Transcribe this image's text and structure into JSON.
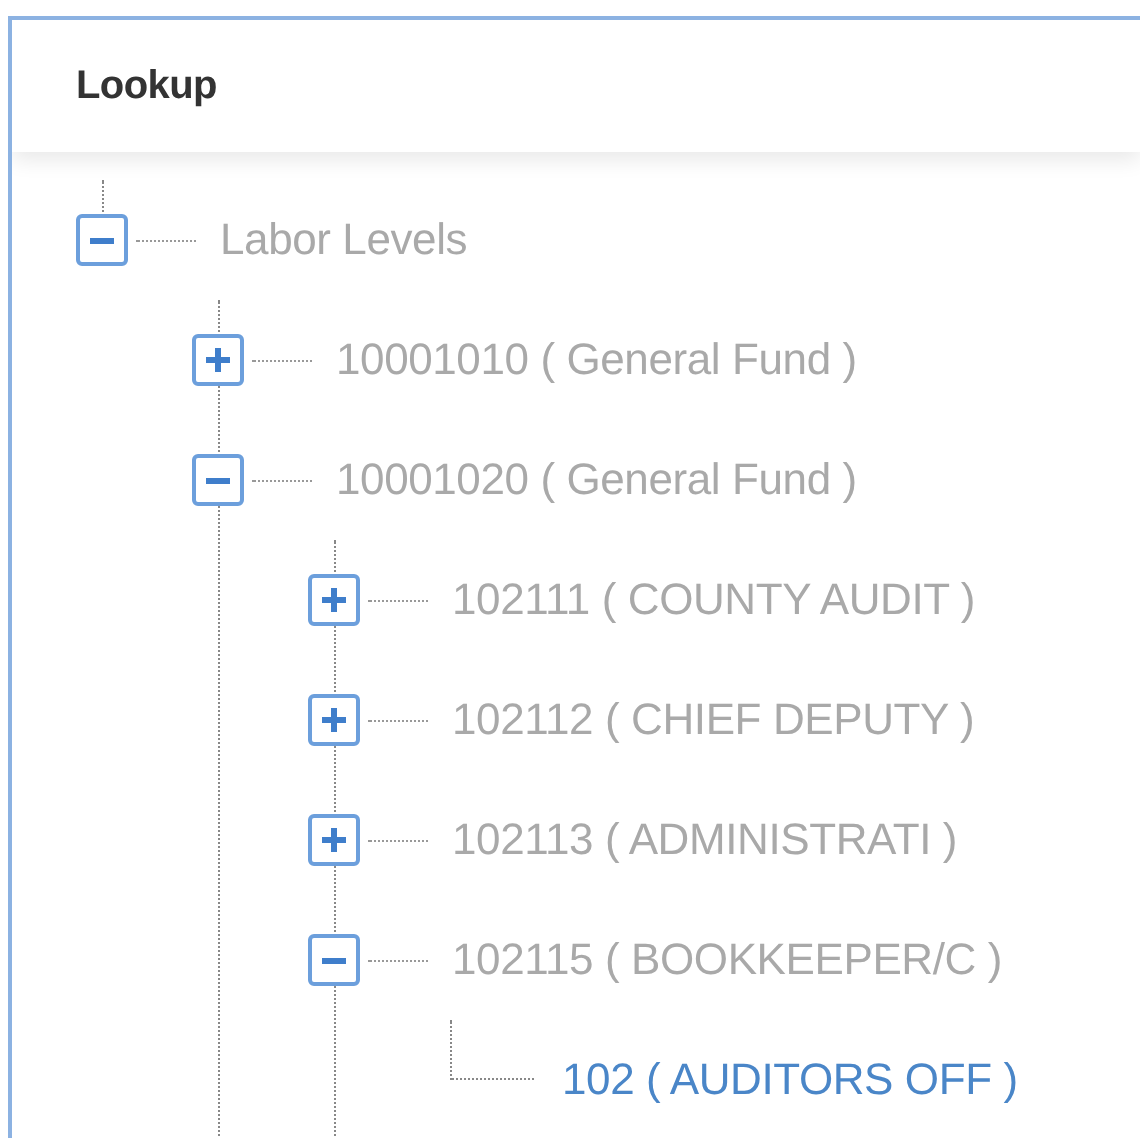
{
  "panel": {
    "title": "Lookup"
  },
  "tree": [
    {
      "kind": "branch",
      "label": "Labor Levels",
      "expanded": true,
      "selected": false,
      "children": [
        {
          "kind": "branch",
          "label": "10001010 ( General Fund )",
          "expanded": false,
          "selected": false
        },
        {
          "kind": "branch",
          "label": "10001020 ( General Fund )",
          "expanded": true,
          "selected": false,
          "children": [
            {
              "kind": "branch",
              "label": "102111 ( COUNTY AUDIT )",
              "expanded": false,
              "selected": false
            },
            {
              "kind": "branch",
              "label": "102112 ( CHIEF DEPUTY )",
              "expanded": false,
              "selected": false
            },
            {
              "kind": "branch",
              "label": "102113 ( ADMINISTRATI )",
              "expanded": false,
              "selected": false
            },
            {
              "kind": "branch",
              "label": "102115 ( BOOKKEEPER/C )",
              "expanded": true,
              "selected": false,
              "children": [
                {
                  "kind": "leaf",
                  "label": "102 ( AUDITORS OFF )",
                  "selected": true
                }
              ]
            }
          ]
        }
      ]
    }
  ]
}
